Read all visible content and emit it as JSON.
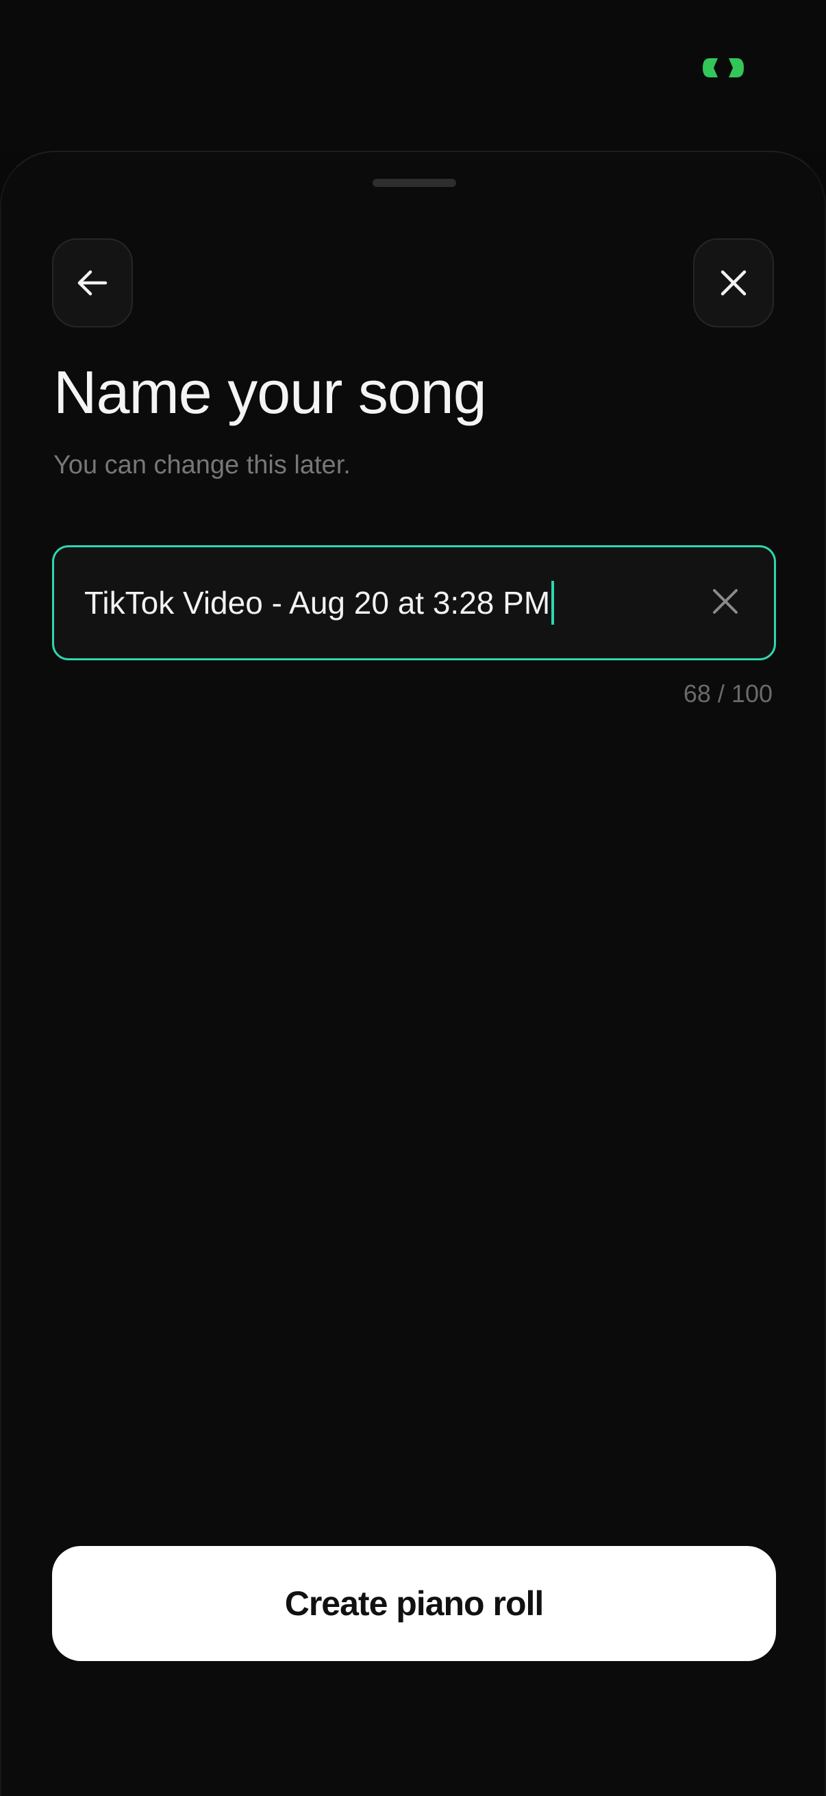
{
  "status_bar": {
    "indicator_icon": "dynamic-island-indicator-icon",
    "indicator_color": "#33c659"
  },
  "sheet": {
    "back_icon": "arrow-left-icon",
    "close_icon": "close-icon",
    "title": "Name your song",
    "subtitle": "You can change this later."
  },
  "song_name_input": {
    "value": "TikTok Video - Aug 20 at 3:28 PM",
    "clear_icon": "clear-x-icon",
    "focus_color": "#2fd6b0"
  },
  "char_counter": {
    "text": "68 / 100"
  },
  "create_button": {
    "label": "Create piano roll"
  }
}
